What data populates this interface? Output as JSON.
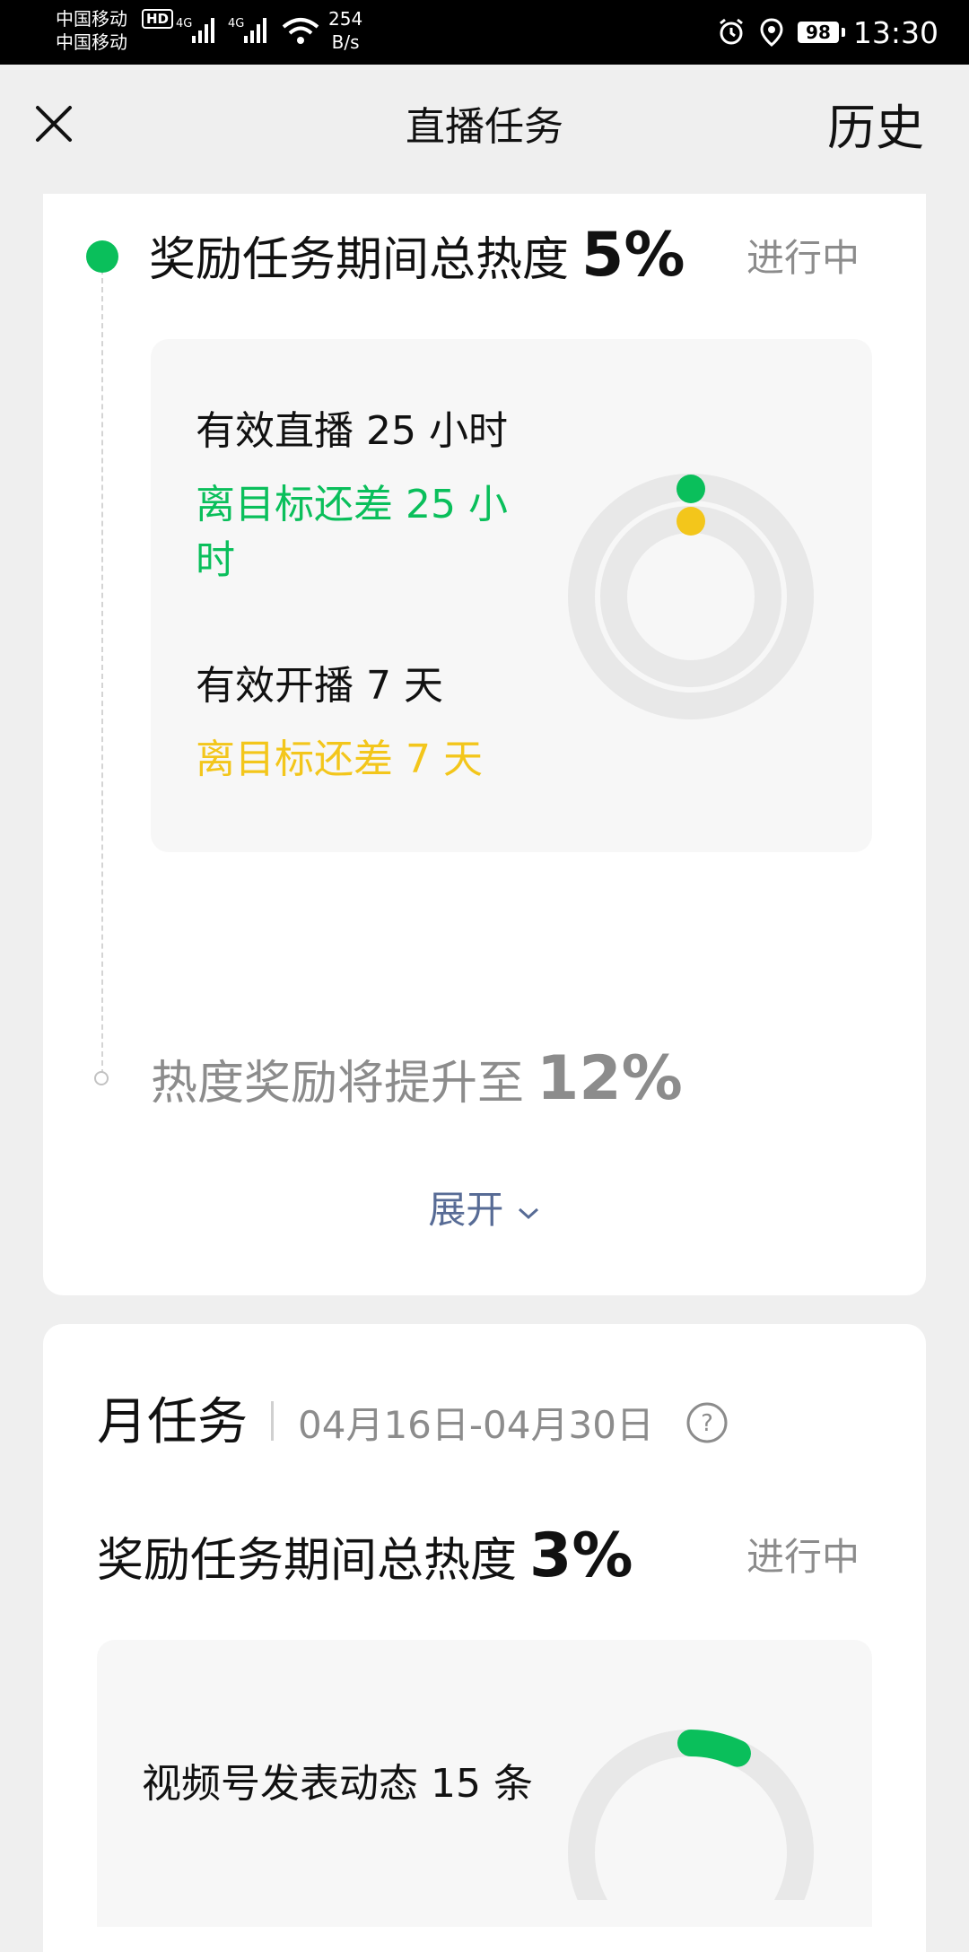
{
  "status_bar": {
    "carrier1": "中国移动",
    "carrier2": "中国移动",
    "hd_badge": "HD",
    "net1": "4G",
    "net2": "4G",
    "speed_value": "254",
    "speed_unit": "B/s",
    "battery": "98",
    "time": "13:30"
  },
  "header": {
    "title": "直播任务",
    "history_label": "历史"
  },
  "task1": {
    "title": "奖励任务期间总热度",
    "heat": "5%",
    "status": "进行中",
    "metric1_label": "有效直播 25 小时",
    "metric1_remaining": "离目标还差 25 小时",
    "metric2_label": "有效开播 7 天",
    "metric2_remaining": "离目标还差 7 天",
    "ring_progress": {
      "outer": 0,
      "inner": 0
    },
    "next_title": "热度奖励将提升至",
    "next_heat": "12%",
    "expand_label": "展开"
  },
  "month_task": {
    "title": "月任务",
    "range": "04月16日-04月30日",
    "heat_title": "奖励任务期间总热度",
    "heat": "3%",
    "status": "进行中",
    "metric1_label": "视频号发表动态 15 条",
    "ring_progress": 0.07
  },
  "colors": {
    "accent_green": "#0abf5b",
    "accent_yellow": "#f3c61b",
    "link_blue": "#576b95"
  }
}
